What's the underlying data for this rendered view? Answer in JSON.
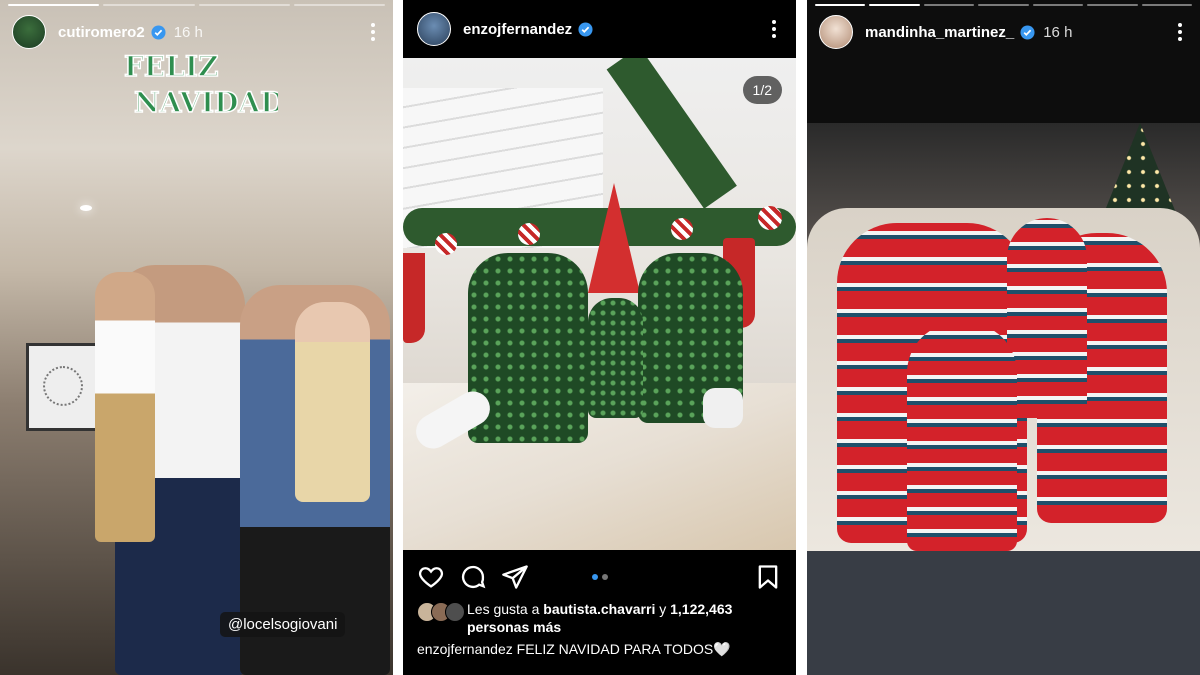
{
  "stories": [
    {
      "username": "cutiromero2",
      "time": "16 h",
      "verified": true,
      "overlay_text": "FELIZ NAVIDAD",
      "mention_tag": "@locelsogiovani",
      "progress_segments": 4,
      "current_segment": 1
    },
    {
      "username": "enzojfernandez",
      "verified": true,
      "image_counter": "1/2",
      "likes_prefix": "Les gusta a ",
      "likes_user": "bautista.chavarri",
      "likes_middle": " y ",
      "likes_count": "1,122,463",
      "likes_suffix": "personas más",
      "caption_user": "enzojfernandez",
      "caption_text": "FELIZ NAVIDAD PARA TODOS🤍"
    },
    {
      "username": "mandinha_martinez_",
      "time": "16 h",
      "verified": true,
      "progress_segments": 7,
      "current_segment": 2
    }
  ],
  "icons": {
    "verified_color": "#3897f0",
    "like": "heart-icon",
    "comment": "comment-icon",
    "share": "send-icon",
    "save": "bookmark-icon",
    "more": "more-vertical-icon"
  }
}
